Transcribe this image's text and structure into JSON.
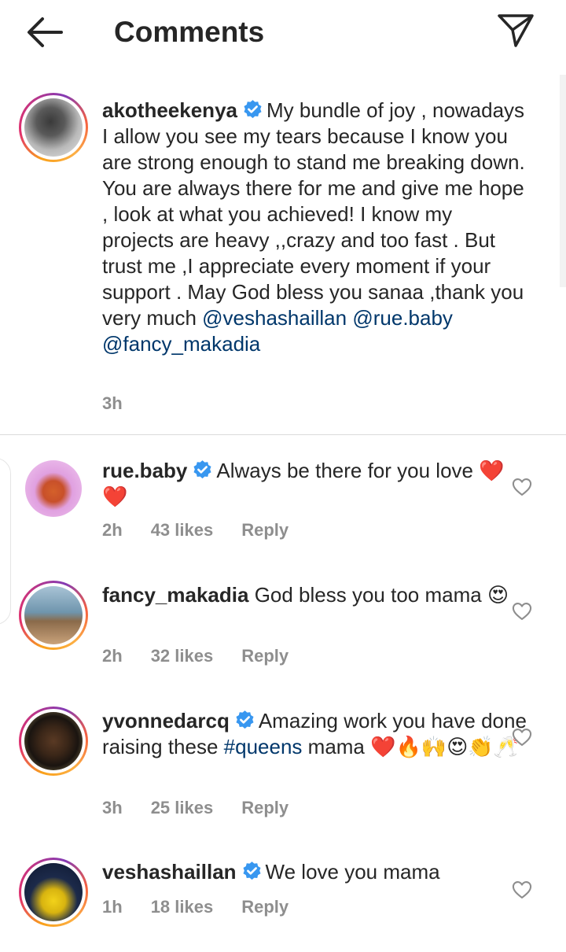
{
  "header": {
    "title": "Comments",
    "back_icon": "arrow-left-icon",
    "send_icon": "paper-plane-icon"
  },
  "caption": {
    "username": "akotheekenya",
    "verified": true,
    "text": "My bundle of joy , nowadays I allow you see my tears because I know you are strong  enough to stand me breaking down. You are always there for me and give me hope , look at what you achieved! I know my projects are heavy ,,crazy and too fast . But trust me ,I appreciate every moment if your support . May God bless you sanaa ,thank you very much",
    "mentions": [
      "@veshashaillan",
      "@rue.baby",
      "@fancy_makadia"
    ],
    "time": "3h"
  },
  "comments": [
    {
      "username": "rue.baby",
      "verified": true,
      "text": "Always be there for you love",
      "emoji": "❤️❤️",
      "time": "2h",
      "likes": "43 likes",
      "reply": "Reply"
    },
    {
      "username": "fancy_makadia",
      "verified": false,
      "text": "God bless you too mama",
      "emoji": "😍",
      "time": "2h",
      "likes": "32 likes",
      "reply": "Reply"
    },
    {
      "username": "yvonnedarcq",
      "verified": true,
      "text_before": "Amazing work you have done raising these",
      "hashtag": "#queens",
      "text_after": "mama",
      "emoji": "❤️🔥🙌😍👏🥂",
      "time": "3h",
      "likes": "25 likes",
      "reply": "Reply"
    },
    {
      "username": "veshashaillan",
      "verified": true,
      "text": "We love you mama",
      "time": "1h",
      "likes": "18 likes",
      "reply": "Reply"
    }
  ],
  "colors": {
    "text": "#262626",
    "meta": "#8e8e8e",
    "link": "#00376b",
    "verified": "#3897f0",
    "heart_emoji": "#e0245e"
  }
}
